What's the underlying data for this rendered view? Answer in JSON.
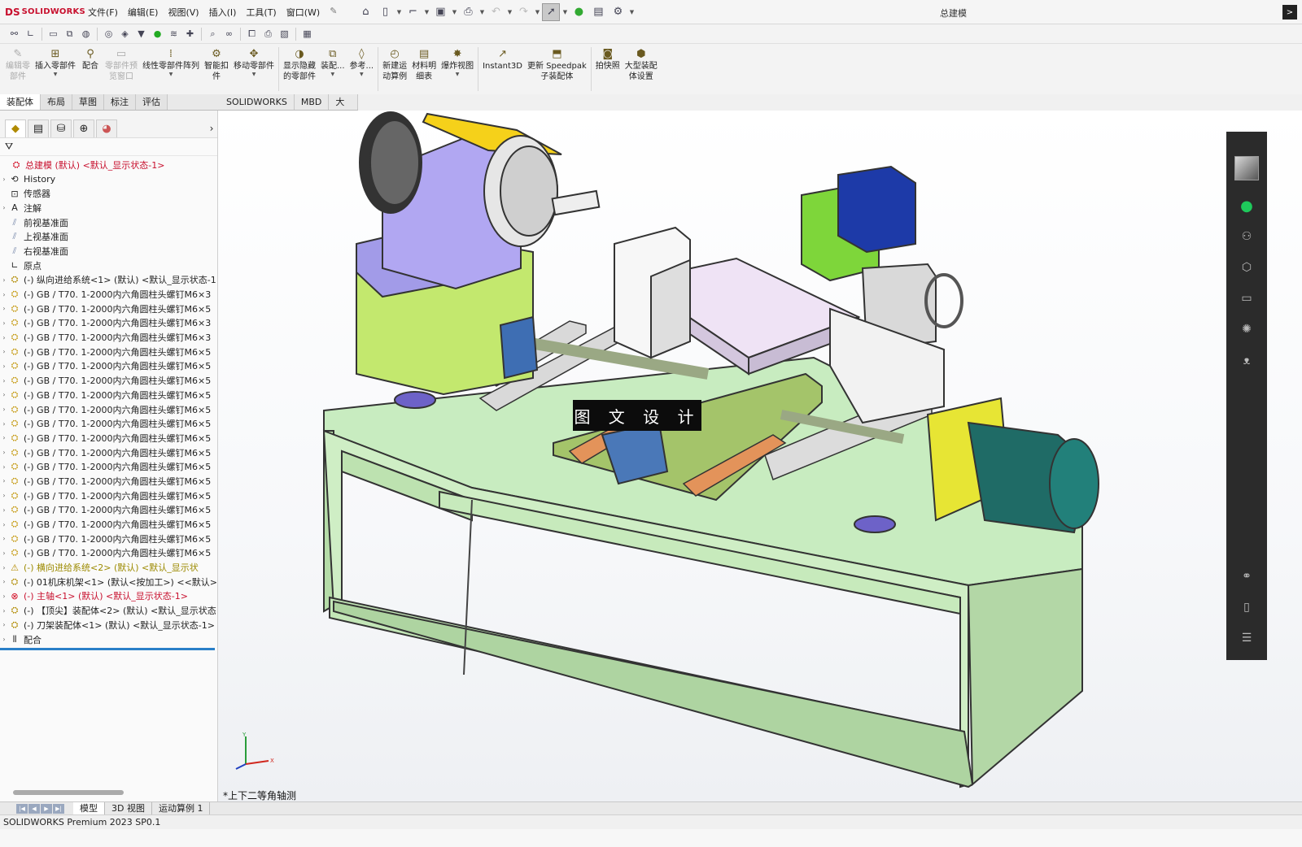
{
  "app": {
    "logo_prefix": "DS",
    "logo_name": "SOLIDWORKS",
    "document_title": "总建模",
    "window_button": ">"
  },
  "menu": [
    "文件(F)",
    "编辑(E)",
    "视图(V)",
    "插入(I)",
    "工具(T)",
    "窗口(W)"
  ],
  "ribbon": [
    {
      "label": "编辑零\n部件",
      "icon": "edit-component-icon",
      "disabled": true,
      "dropdown": false
    },
    {
      "label": "插入零部件",
      "icon": "insert-component-icon",
      "disabled": false,
      "dropdown": true
    },
    {
      "label": "配合",
      "icon": "mate-icon",
      "disabled": false,
      "dropdown": false
    },
    {
      "label": "零部件预\n览窗口",
      "icon": "preview-window-icon",
      "disabled": true,
      "dropdown": false
    },
    {
      "label": "线性零部件阵列",
      "icon": "linear-pattern-icon",
      "disabled": false,
      "dropdown": true
    },
    {
      "label": "智能扣\n件",
      "icon": "smart-fasteners-icon",
      "disabled": false,
      "dropdown": false
    },
    {
      "label": "移动零部件",
      "icon": "move-component-icon",
      "disabled": false,
      "dropdown": true
    },
    {
      "label": "显示隐藏\n的零部件",
      "icon": "show-hidden-icon",
      "disabled": false,
      "dropdown": false
    },
    {
      "label": "装配...",
      "icon": "assembly-features-icon",
      "disabled": false,
      "dropdown": true
    },
    {
      "label": "参考...",
      "icon": "reference-geometry-icon",
      "disabled": false,
      "dropdown": true
    },
    {
      "label": "新建运\n动算例",
      "icon": "new-motion-study-icon",
      "disabled": false,
      "dropdown": false
    },
    {
      "label": "材料明\n细表",
      "icon": "bom-icon",
      "disabled": false,
      "dropdown": false
    },
    {
      "label": "爆炸视图",
      "icon": "exploded-view-icon",
      "disabled": false,
      "dropdown": true
    },
    {
      "label": "Instant3D",
      "icon": "instant3d-icon",
      "disabled": false,
      "dropdown": false
    },
    {
      "label": "更新 Speedpak\n子装配体",
      "icon": "speedpak-icon",
      "disabled": false,
      "dropdown": false
    },
    {
      "label": "拍快照",
      "icon": "snapshot-icon",
      "disabled": false,
      "dropdown": false
    },
    {
      "label": "大型装配\n体设置",
      "icon": "large-assembly-icon",
      "disabled": false,
      "dropdown": false
    }
  ],
  "tabs": [
    "装配体",
    "布局",
    "草图",
    "标注",
    "评估",
    "SOLIDWORKS 插件",
    "MBD",
    "大国工匠"
  ],
  "active_tab": "装配体",
  "tree": [
    {
      "text": "总建模 (默认) <默认_显示状态-1>",
      "type": "root",
      "icon": "assembly-error-icon",
      "style": "red",
      "expand": false
    },
    {
      "text": "History",
      "type": "history",
      "icon": "history-icon",
      "style": "",
      "expand": true
    },
    {
      "text": "传感器",
      "type": "sensor",
      "icon": "sensor-icon",
      "style": "",
      "expand": false
    },
    {
      "text": "注解",
      "type": "annotation",
      "icon": "annotation-icon",
      "style": "",
      "expand": true
    },
    {
      "text": "前视基准面",
      "type": "plane",
      "icon": "plane-icon",
      "style": "",
      "expand": false
    },
    {
      "text": "上视基准面",
      "type": "plane",
      "icon": "plane-icon",
      "style": "",
      "expand": false
    },
    {
      "text": "右视基准面",
      "type": "plane",
      "icon": "plane-icon",
      "style": "",
      "expand": false
    },
    {
      "text": "原点",
      "type": "origin",
      "icon": "origin-icon",
      "style": "",
      "expand": false
    },
    {
      "text": "(-) 纵向进给系统<1> (默认) <默认_显示状态-1",
      "type": "asm",
      "icon": "subassembly-icon",
      "style": "",
      "expand": true
    },
    {
      "text": "(-) GB / T70. 1-2000内六角圆柱头螺钉M6×3",
      "type": "part",
      "icon": "part-icon",
      "style": "",
      "expand": true
    },
    {
      "text": "(-) GB / T70. 1-2000内六角圆柱头螺钉M6×5",
      "type": "part",
      "icon": "part-icon",
      "style": "",
      "expand": true
    },
    {
      "text": "(-) GB / T70. 1-2000内六角圆柱头螺钉M6×3",
      "type": "part",
      "icon": "part-icon",
      "style": "",
      "expand": true
    },
    {
      "text": "(-) GB / T70. 1-2000内六角圆柱头螺钉M6×3",
      "type": "part",
      "icon": "part-icon",
      "style": "",
      "expand": true
    },
    {
      "text": "(-) GB / T70. 1-2000内六角圆柱头螺钉M6×5",
      "type": "part",
      "icon": "part-icon",
      "style": "",
      "expand": true
    },
    {
      "text": "(-) GB / T70. 1-2000内六角圆柱头螺钉M6×5",
      "type": "part",
      "icon": "part-icon",
      "style": "",
      "expand": true
    },
    {
      "text": "(-) GB / T70. 1-2000内六角圆柱头螺钉M6×5",
      "type": "part",
      "icon": "part-icon",
      "style": "",
      "expand": true
    },
    {
      "text": "(-) GB / T70. 1-2000内六角圆柱头螺钉M6×5",
      "type": "part",
      "icon": "part-icon",
      "style": "",
      "expand": true
    },
    {
      "text": "(-) GB / T70. 1-2000内六角圆柱头螺钉M6×5",
      "type": "part",
      "icon": "part-icon",
      "style": "",
      "expand": true
    },
    {
      "text": "(-) GB / T70. 1-2000内六角圆柱头螺钉M6×5",
      "type": "part",
      "icon": "part-icon",
      "style": "",
      "expand": true
    },
    {
      "text": "(-) GB / T70. 1-2000内六角圆柱头螺钉M6×5",
      "type": "part",
      "icon": "part-icon",
      "style": "",
      "expand": true
    },
    {
      "text": "(-) GB / T70. 1-2000内六角圆柱头螺钉M6×5",
      "type": "part",
      "icon": "part-icon",
      "style": "",
      "expand": true
    },
    {
      "text": "(-) GB / T70. 1-2000内六角圆柱头螺钉M6×5",
      "type": "part",
      "icon": "part-icon",
      "style": "",
      "expand": true
    },
    {
      "text": "(-) GB / T70. 1-2000内六角圆柱头螺钉M6×5",
      "type": "part",
      "icon": "part-icon",
      "style": "",
      "expand": true
    },
    {
      "text": "(-) GB / T70. 1-2000内六角圆柱头螺钉M6×5",
      "type": "part",
      "icon": "part-icon",
      "style": "",
      "expand": true
    },
    {
      "text": "(-) GB / T70. 1-2000内六角圆柱头螺钉M6×5",
      "type": "part",
      "icon": "part-icon",
      "style": "",
      "expand": true
    },
    {
      "text": "(-) GB / T70. 1-2000内六角圆柱头螺钉M6×5",
      "type": "part",
      "icon": "part-icon",
      "style": "",
      "expand": true
    },
    {
      "text": "(-) GB / T70. 1-2000内六角圆柱头螺钉M6×5",
      "type": "part",
      "icon": "part-icon",
      "style": "",
      "expand": true
    },
    {
      "text": "(-) GB / T70. 1-2000内六角圆柱头螺钉M6×5",
      "type": "part",
      "icon": "part-icon",
      "style": "",
      "expand": true
    },
    {
      "text": "(-) 横向进给系统<2> (默认) <默认_显示状",
      "type": "asm",
      "icon": "subassembly-warning-icon",
      "style": "warn",
      "expand": true
    },
    {
      "text": "(-) 01机床机架<1> (默认<按加工>) <<默认>",
      "type": "asm",
      "icon": "subassembly-icon",
      "style": "",
      "expand": true
    },
    {
      "text": "(-) 主轴<1> (默认) <默认_显示状态-1>",
      "type": "asm",
      "icon": "subassembly-error-icon",
      "style": "red",
      "expand": true
    },
    {
      "text": "(-) 【顶尖】装配体<2> (默认) <默认_显示状态",
      "type": "asm",
      "icon": "subassembly-icon",
      "style": "",
      "expand": true
    },
    {
      "text": "(-) 刀架装配体<1> (默认) <默认_显示状态-1>",
      "type": "asm",
      "icon": "subassembly-icon",
      "style": "",
      "expand": true
    },
    {
      "text": "配合",
      "type": "mates",
      "icon": "mates-icon",
      "style": "",
      "expand": true
    }
  ],
  "viewport": {
    "view_name": "*上下二等角轴测",
    "watermark": "图 文 设 计"
  },
  "bottom_tabs": [
    "模型",
    "3D 视图",
    "运动算例 1"
  ],
  "active_bottom_tab": "模型",
  "status": "SOLIDWORKS Premium 2023 SP0.1",
  "colors": {
    "brand_red": "#c8102e",
    "tree_selection_blue": "#2a7fc8",
    "sidebar_dark": "#2b2b2b",
    "wechat_green": "#1ec95b"
  }
}
